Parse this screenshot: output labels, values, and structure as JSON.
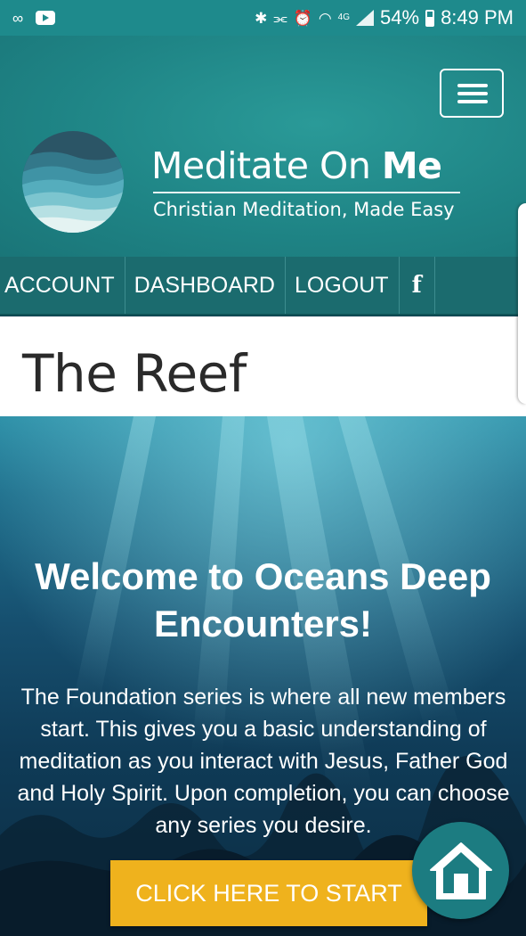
{
  "status_bar": {
    "battery": "54%",
    "time": "8:49 PM",
    "network": "4G"
  },
  "brand": {
    "title_regular": "Meditate On ",
    "title_bold": "Me",
    "tagline": "Christian Meditation, Made Easy"
  },
  "nav": {
    "items": [
      {
        "label": "ACCOUNT"
      },
      {
        "label": "DASHBOARD"
      },
      {
        "label": "LOGOUT"
      },
      {
        "label": "f"
      }
    ]
  },
  "page": {
    "title": "The Reef"
  },
  "hero": {
    "heading": "Welcome to Oceans Deep Encounters!",
    "body": "The Foundation series is where all new members start. This gives you a basic understanding of meditation as you interact with Jesus, Father God and Holy Spirit. Upon completion, you can choose any series you desire.",
    "cta_label": "CLICK HERE TO START"
  },
  "icons": {
    "menu": "hamburger-menu-icon",
    "home": "home-icon",
    "facebook": "facebook-icon"
  },
  "colors": {
    "status_bar": "#1e8a8c",
    "header": "#1f8586",
    "nav": "#1b6b6e",
    "cta": "#efb21d",
    "home_fab": "#1c7c81"
  }
}
